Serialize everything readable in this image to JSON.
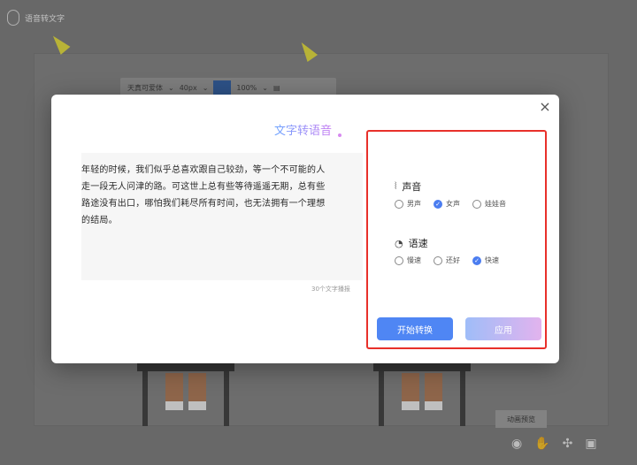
{
  "app": {
    "title": "语音转文字",
    "toolbar": {
      "font": "天真可爱体",
      "size": "40px",
      "zoom": "100%"
    },
    "preview_label": "动画预览",
    "bottom_icons": [
      "eye-icon",
      "hand-icon",
      "network-icon",
      "clipboard-icon"
    ]
  },
  "modal": {
    "title": "文字转语音",
    "text": "年轻的时候，我们似乎总喜欢跟自己较劲，等一个不可能的人\n走一段无人问津的路。可这世上总有些等待遥遥无期，总有些\n路途没有出口，哪怕我们耗尽所有时间，也无法拥有一个理想\n的结局。",
    "char_count": "30个文字播报",
    "voice": {
      "label": "声音",
      "options": [
        "男声",
        "女声",
        "娃娃音"
      ],
      "selected": "女声"
    },
    "speed": {
      "label": "语速",
      "options": [
        "慢速",
        "还好",
        "快速"
      ],
      "selected": "快速"
    },
    "buttons": {
      "start": "开始转换",
      "apply": "应用"
    },
    "colors": {
      "accent": "#4f86f4",
      "highlight_border": "#e8302a"
    }
  }
}
